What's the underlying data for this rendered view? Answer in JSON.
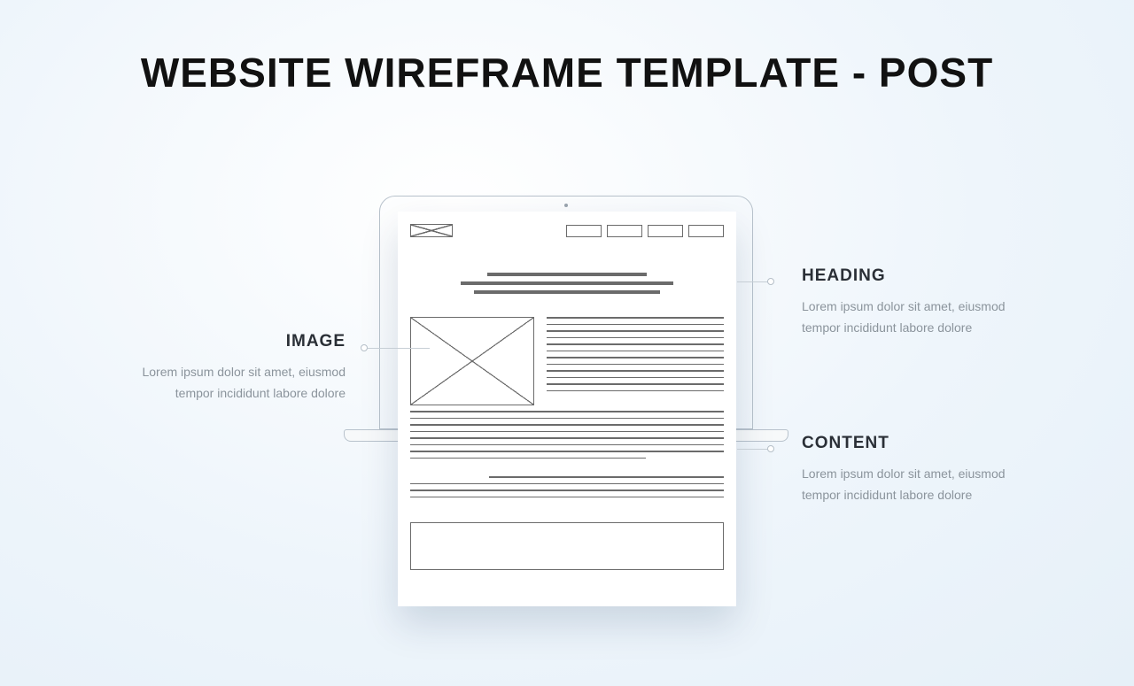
{
  "title": "WEBSITE WIREFRAME TEMPLATE - POST",
  "callouts": {
    "image": {
      "heading": "IMAGE",
      "body": "Lorem ipsum dolor sit amet, eiusmod tempor incididunt labore dolore"
    },
    "heading": {
      "heading": "HEADING",
      "body": "Lorem ipsum dolor sit amet, eiusmod tempor incididunt labore dolore"
    },
    "content": {
      "heading": "CONTENT",
      "body": "Lorem ipsum dolor sit amet, eiusmod tempor incididunt labore dolore"
    }
  }
}
